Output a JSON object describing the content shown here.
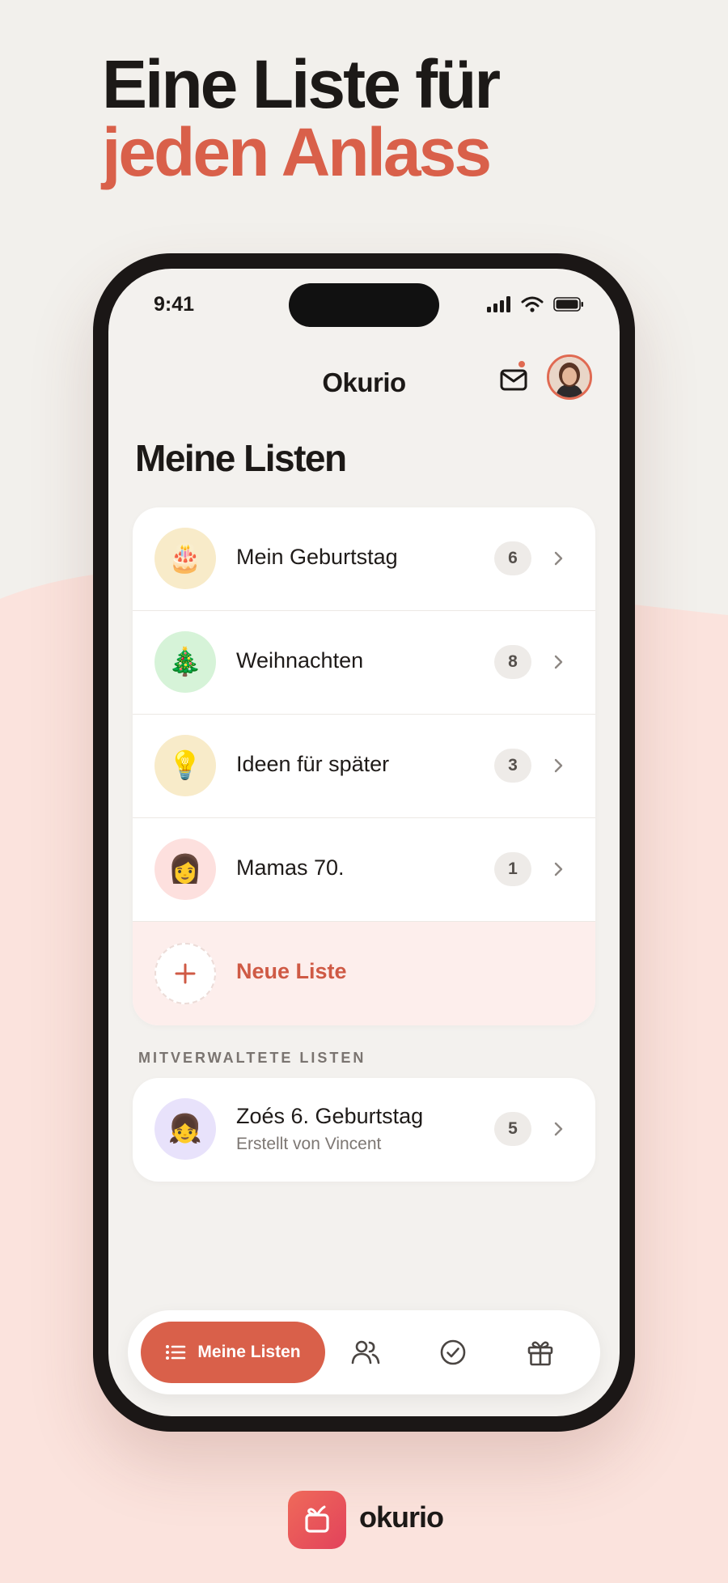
{
  "headline": {
    "line1": "Eine Liste für",
    "line2": "jeden Anlass"
  },
  "status": {
    "time": "9:41"
  },
  "header": {
    "app_title": "Okurio"
  },
  "page": {
    "title": "Meine Listen"
  },
  "lists": [
    {
      "emoji": "🎂",
      "label": "Mein Geburtstag",
      "count": "6",
      "bg": "#f8ebc9"
    },
    {
      "emoji": "🎄",
      "label": "Weihnachten",
      "count": "8",
      "bg": "#d6f3d8"
    },
    {
      "emoji": "💡",
      "label": "Ideen für später",
      "count": "3",
      "bg": "#f8ebc9"
    },
    {
      "emoji": "👩",
      "label": "Mamas 70.",
      "count": "1",
      "bg": "#fde0de"
    }
  ],
  "new_list": {
    "label": "Neue Liste"
  },
  "shared": {
    "section_title": "MITVERWALTETE LISTEN",
    "items": [
      {
        "emoji": "👧",
        "label": "Zoés 6. Geburtstag",
        "sub": "Erstellt von Vincent",
        "count": "5",
        "bg": "#e8e2fb"
      }
    ]
  },
  "tabbar": {
    "active_label": "Meine Listen"
  },
  "footer": {
    "brand": "okurio"
  },
  "colors": {
    "accent": "#d9604a",
    "background": "#f2f0ec",
    "wave": "#fbe0da"
  }
}
